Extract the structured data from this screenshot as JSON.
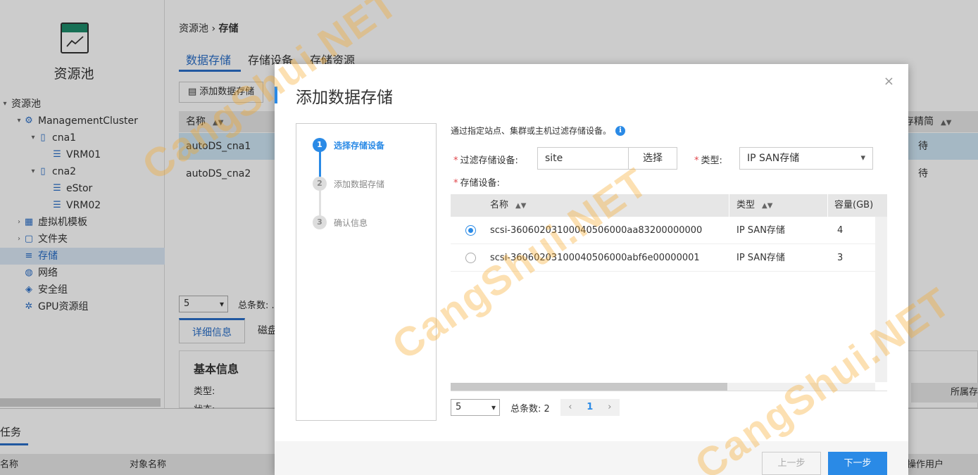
{
  "app": {
    "title": "资源池"
  },
  "tree": [
    {
      "label": "资源池",
      "level": 0,
      "chevron": "▾",
      "icon": "none"
    },
    {
      "label": "ManagementCluster",
      "level": 1,
      "chevron": "▾",
      "icon": "cluster-icon"
    },
    {
      "label": "cna1",
      "level": 2,
      "chevron": "▾",
      "icon": "host-icon"
    },
    {
      "label": "VRM01",
      "level": 3,
      "chevron": "",
      "icon": "vm-icon"
    },
    {
      "label": "cna2",
      "level": 2,
      "chevron": "▾",
      "icon": "host-icon"
    },
    {
      "label": "eStor",
      "level": 3,
      "chevron": "",
      "icon": "vm-icon"
    },
    {
      "label": "VRM02",
      "level": 3,
      "chevron": "",
      "icon": "vm-icon"
    },
    {
      "label": "虚拟机模板",
      "level": 1,
      "chevron": "›",
      "icon": "template-icon"
    },
    {
      "label": "文件夹",
      "level": 1,
      "chevron": "›",
      "icon": "folder-icon"
    },
    {
      "label": "存储",
      "level": 1,
      "chevron": "",
      "icon": "storage-icon",
      "selected": true
    },
    {
      "label": "网络",
      "level": 1,
      "chevron": "",
      "icon": "network-icon"
    },
    {
      "label": "安全组",
      "level": 1,
      "chevron": "",
      "icon": "security-icon"
    },
    {
      "label": "GPU资源组",
      "level": 1,
      "chevron": "",
      "icon": "gpu-icon"
    }
  ],
  "breadcrumb": {
    "parent": "资源池",
    "sep": "›",
    "current": "存储"
  },
  "tabs": [
    "数据存储",
    "存储设备",
    "存储资源"
  ],
  "toolbar": {
    "add_label": "添加数据存储"
  },
  "bg_table": {
    "col_name": "名称",
    "col_right": "存精简",
    "rows": [
      {
        "name": "autoDS_cna1",
        "right": "待"
      },
      {
        "name": "autoDS_cna2",
        "right": "待"
      }
    ]
  },
  "bg_pager": {
    "size": "5",
    "total_label": "总条数: ."
  },
  "detail_tabs": [
    "详细信息",
    "磁盘"
  ],
  "basic_info": {
    "title": "基本信息",
    "type_label": "类型:",
    "status_label": "状态:"
  },
  "right_col_head": "所属存",
  "task_panel": {
    "title": "任务",
    "col_name": "名称",
    "col_object": "对象名称",
    "col_user": "操作用户"
  },
  "modal": {
    "title": "添加数据存储",
    "close": "×",
    "steps": [
      {
        "num": "1",
        "label": "选择存储设备"
      },
      {
        "num": "2",
        "label": "添加数据存储"
      },
      {
        "num": "3",
        "label": "确认信息"
      }
    ],
    "hint": "通过指定站点、集群或主机过滤存储设备。",
    "info_icon": "i",
    "req_mark": "*",
    "filter_label": "过滤存储设备:",
    "filter_value": "site",
    "choose_label": "选择",
    "type_label": "类型:",
    "type_value": "IP SAN存储",
    "devices_label": "存储设备:",
    "grid": {
      "col_name": "名称",
      "col_type": "类型",
      "col_capacity": "容量(GB)",
      "rows": [
        {
          "name": "scsi-36060203100040506000aa83200000000",
          "type": "IP SAN存储",
          "capacity": "4",
          "selected": true
        },
        {
          "name": "scsi-36060203100040506000abf6e00000001",
          "type": "IP SAN存储",
          "capacity": "3",
          "selected": false
        }
      ]
    },
    "pager": {
      "size": "5",
      "total_label": "总条数: 2",
      "prev": "‹",
      "page": "1",
      "next": "›"
    },
    "prev_label": "上一步",
    "next_label": "下一步"
  },
  "watermarks": [
    "CangShui.NET",
    "CangShui.NET",
    "CangShui.NET"
  ],
  "colors": {
    "accent": "#2a8ae6",
    "required": "#e0464b",
    "selected_row": "#cfe7f5",
    "watermark": "#f5a623"
  }
}
